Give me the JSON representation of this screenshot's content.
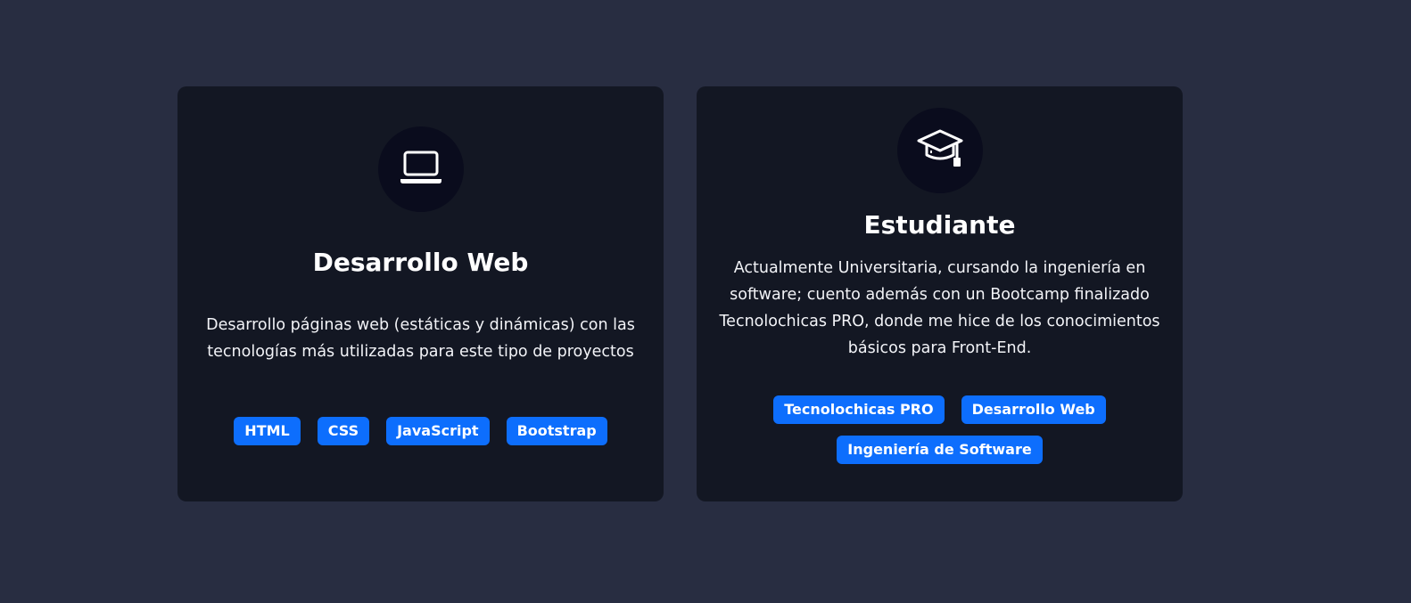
{
  "cards": [
    {
      "icon": "laptop-icon",
      "title": "Desarrollo Web",
      "text": "Desarrollo páginas web (estáticas y dinámicas) con las tecnologías más utilizadas para este tipo de proyectos",
      "tags": [
        "HTML",
        "CSS",
        "JavaScript",
        "Bootstrap"
      ]
    },
    {
      "icon": "graduation-cap-icon",
      "title": "Estudiante",
      "text": "Actualmente Universitaria, cursando la ingeniería en software; cuento además con un Bootcamp finalizado Tecnolochicas PRO, donde me hice de los conocimientos básicos para Front-End.",
      "tags": [
        "Tecnolochicas PRO",
        "Desarrollo Web",
        "Ingeniería de Software"
      ]
    }
  ],
  "colors": {
    "page_background": "#282d41",
    "card_background": "#131723",
    "icon_circle": "#0a0c1d",
    "tag_background": "#0d6efd"
  }
}
